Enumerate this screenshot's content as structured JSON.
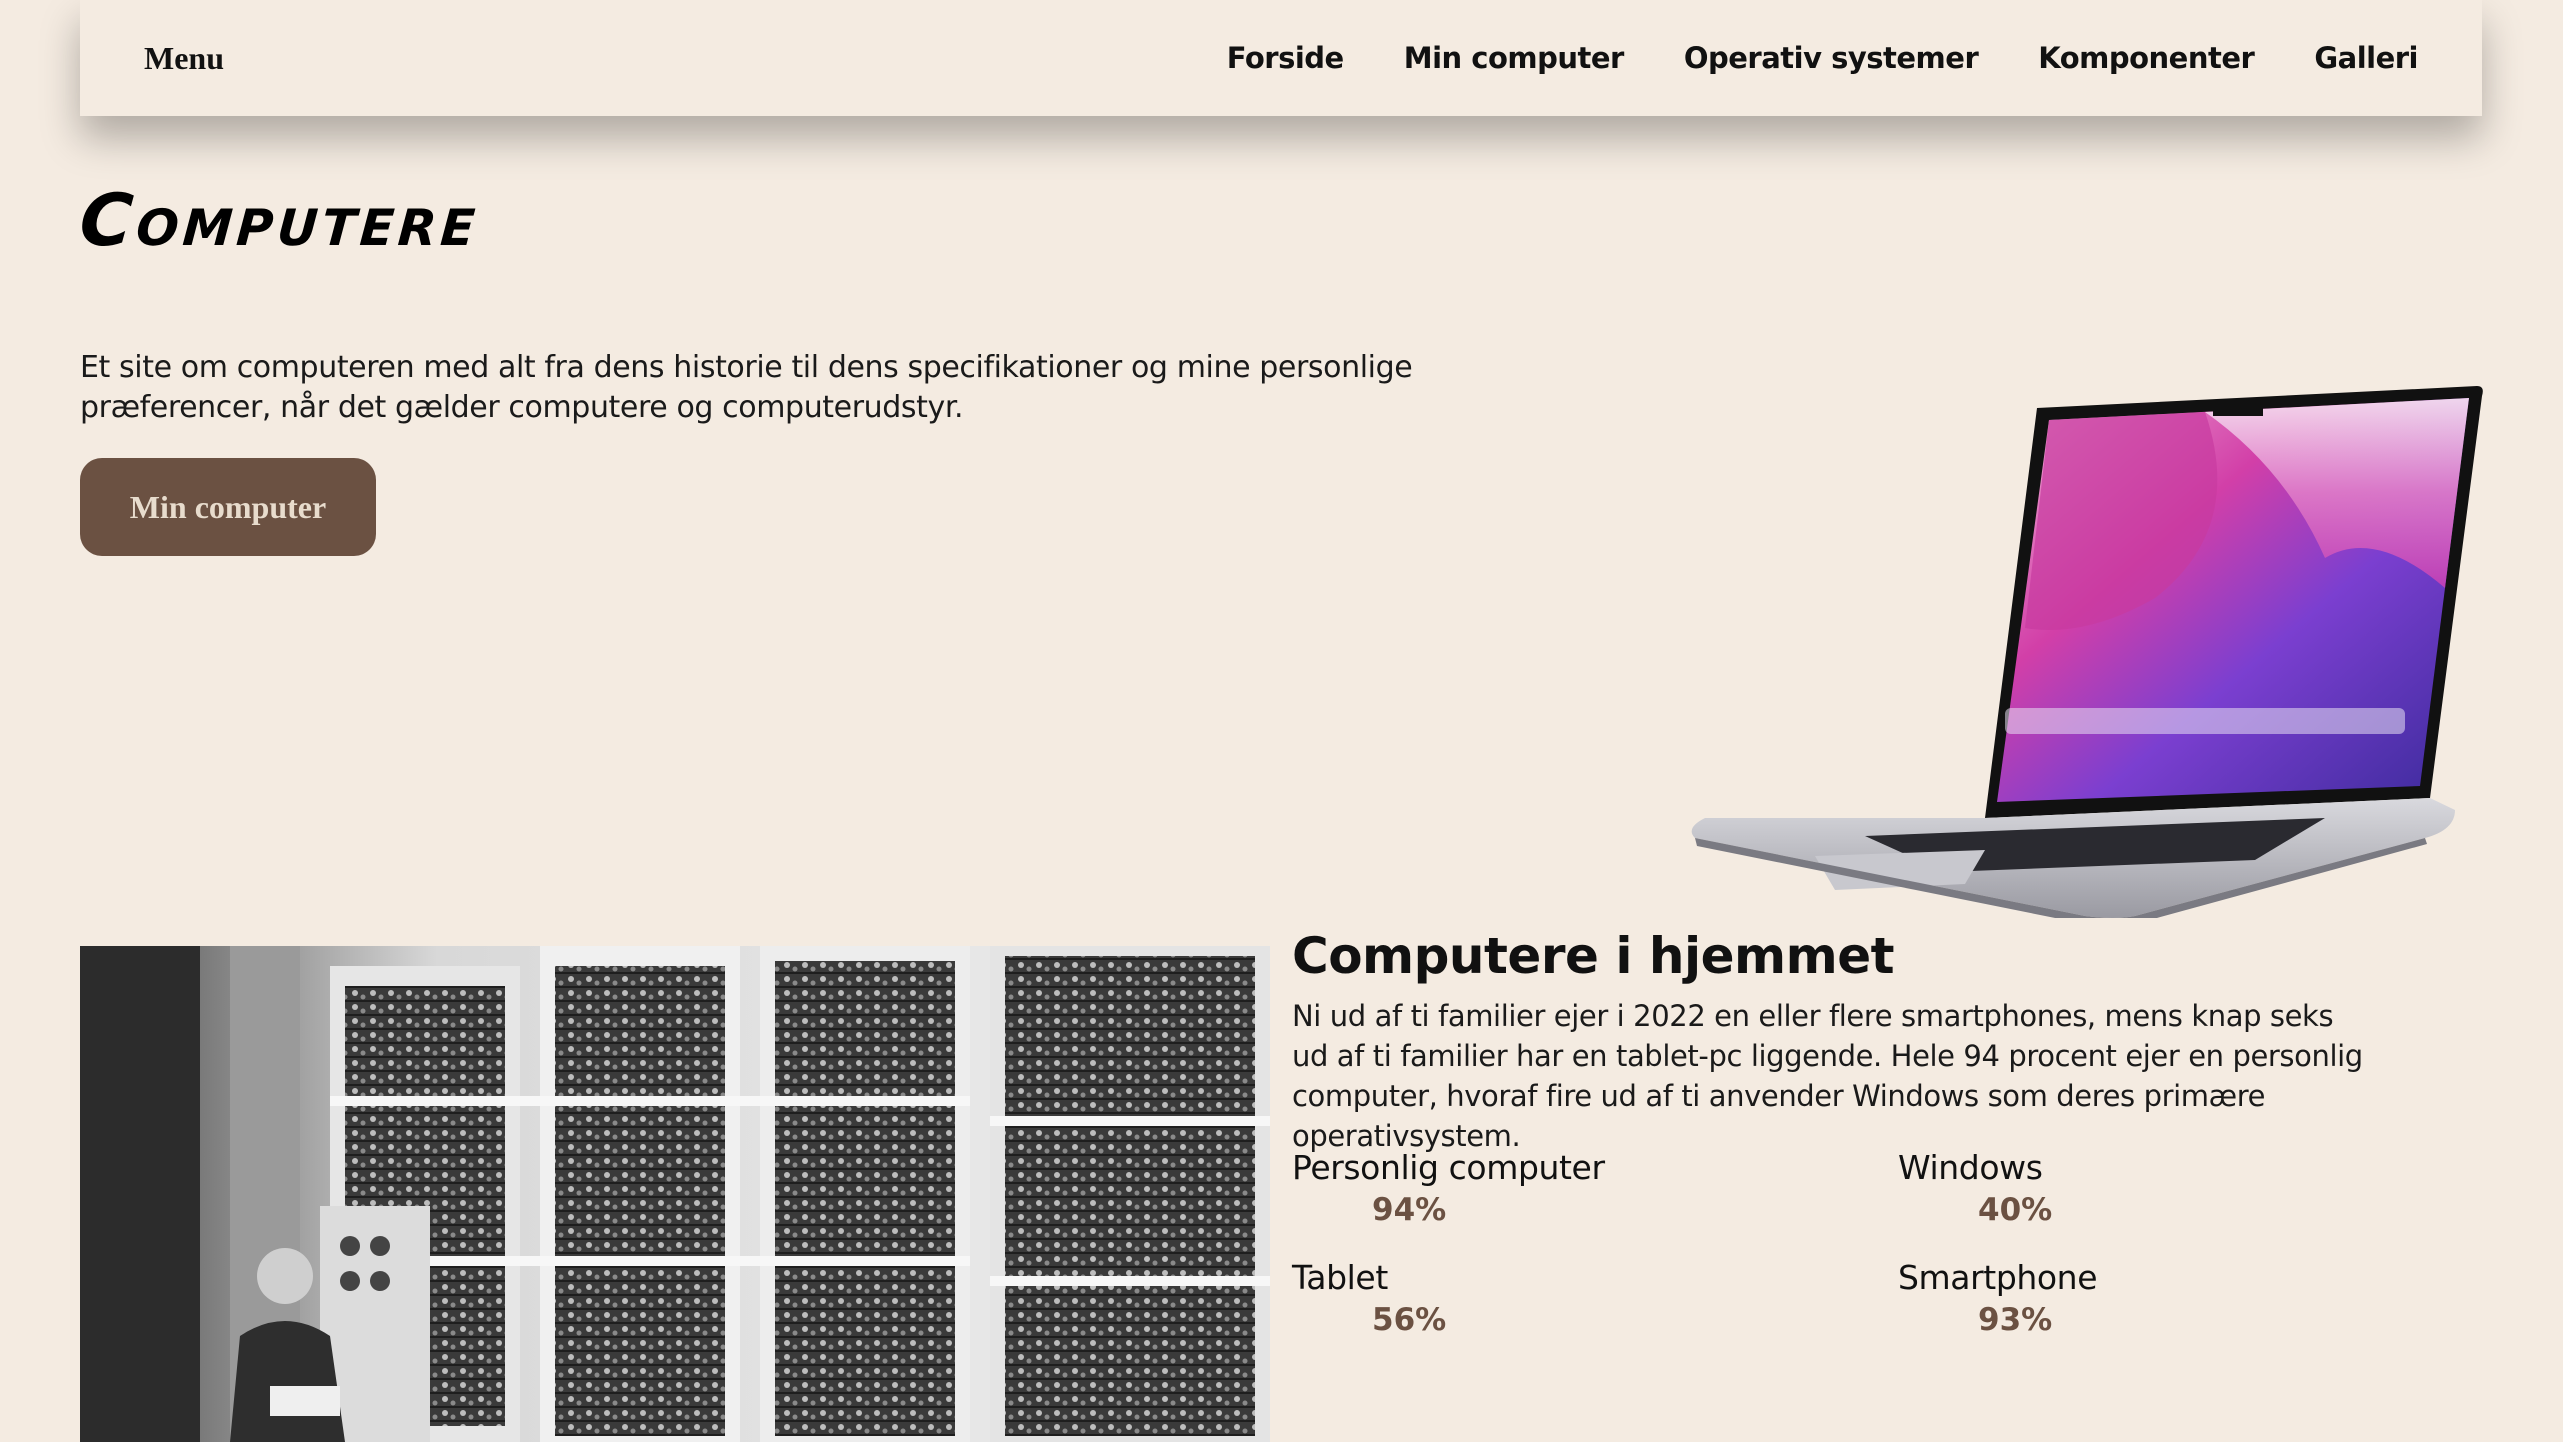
{
  "nav": {
    "menu_label": "Menu",
    "links": [
      "Forside",
      "Min computer",
      "Operativ systemer",
      "Komponenter",
      "Galleri"
    ]
  },
  "hero": {
    "title": "Computere",
    "intro": "Et site om computeren med alt fra dens historie til dens specifikationer og mine personlige præferencer, når det gælder computere og computerudstyr.",
    "button_label": "Min computer"
  },
  "home_section": {
    "title": "Computere i hjemmet",
    "text": "Ni ud af ti familier ejer i 2022 en eller flere smartphones, mens knap seks ud af ti familier har en tablet-pc liggende. Hele 94 procent ejer en personlig computer, hvoraf fire ud af ti anvender Windows som deres primære operativsystem.",
    "stats": [
      {
        "label": "Personlig computer",
        "value": "94%"
      },
      {
        "label": "Windows",
        "value": "40%"
      },
      {
        "label": "Tablet",
        "value": "56%"
      },
      {
        "label": "Smartphone",
        "value": "93%"
      }
    ]
  },
  "colors": {
    "background": "#f4ebe1",
    "accent": "#6b5142",
    "button_text": "#e8dccd"
  },
  "images": {
    "laptop": "laptop-image",
    "historic_computer": "historic-computer-photo"
  }
}
